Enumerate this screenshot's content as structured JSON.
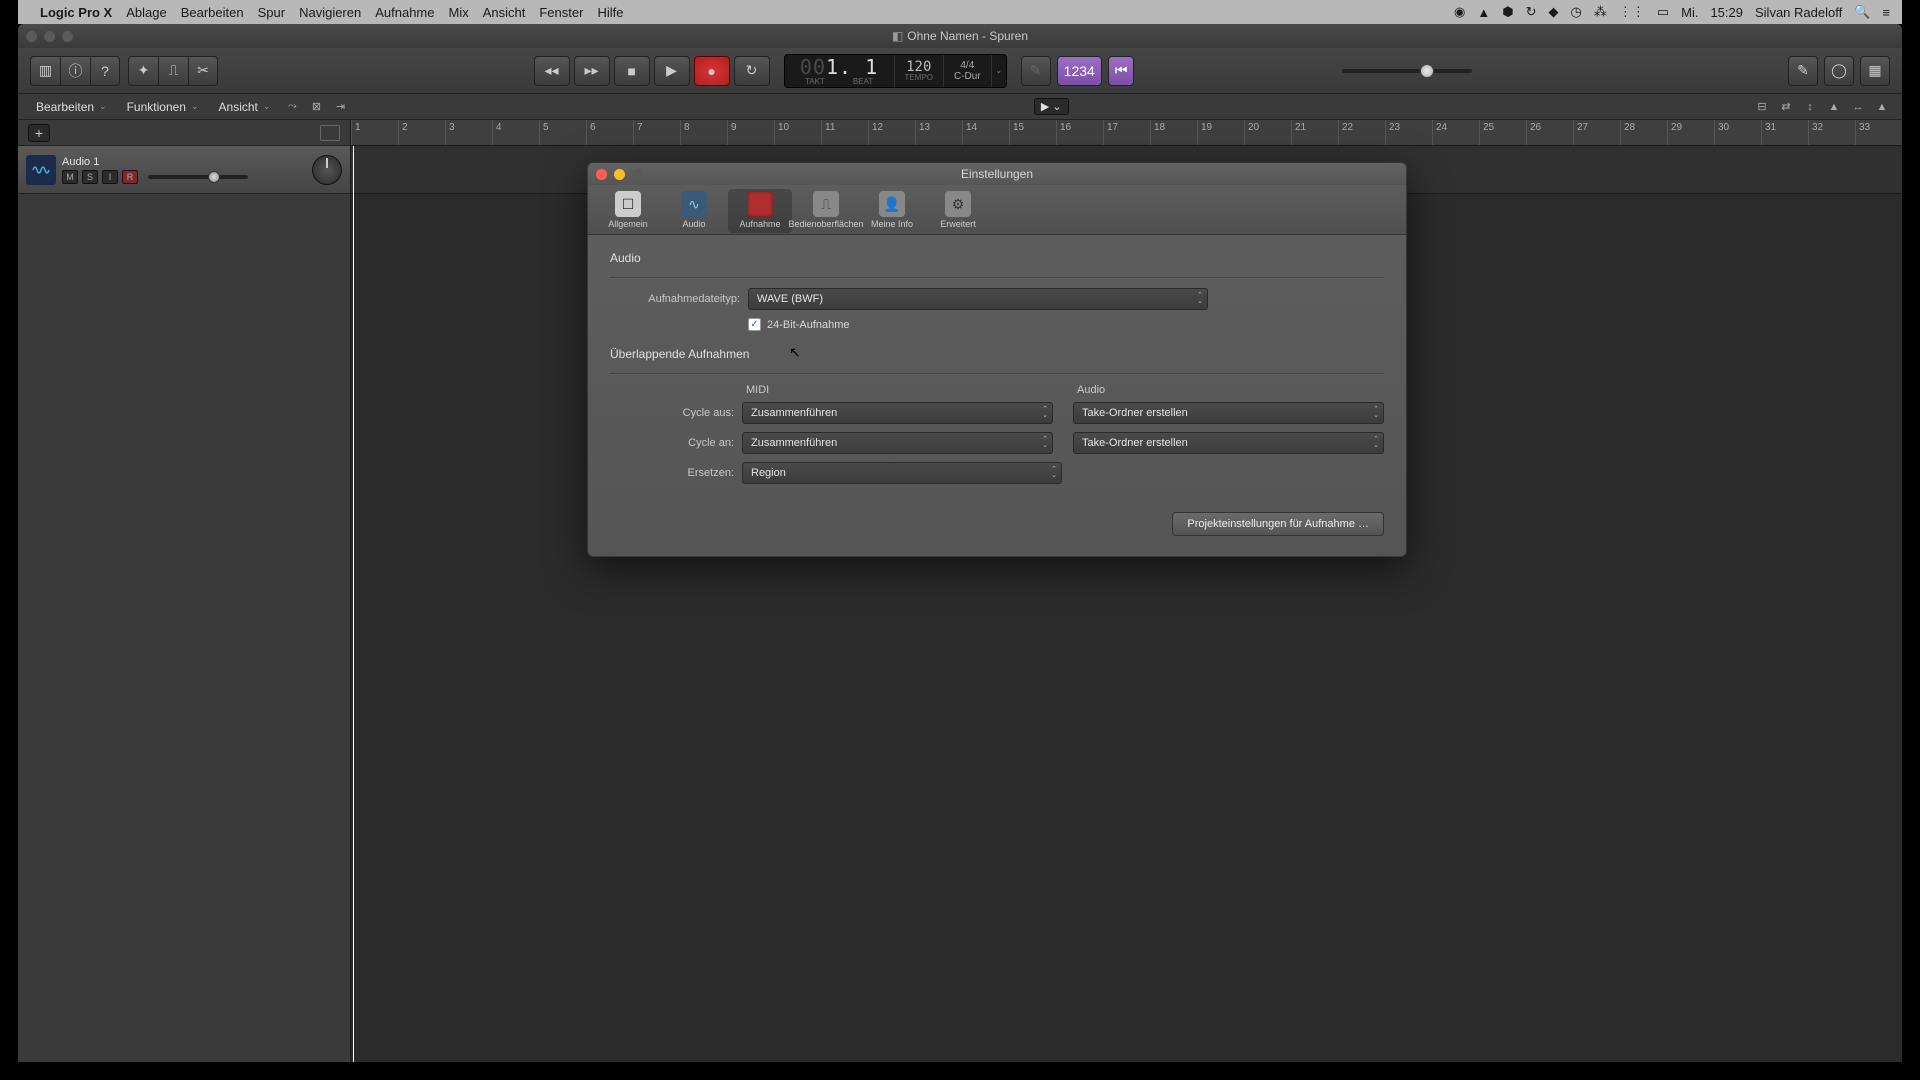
{
  "menubar": {
    "appname": "Logic Pro X",
    "items": [
      "Ablage",
      "Bearbeiten",
      "Spur",
      "Navigieren",
      "Aufnahme",
      "Mix",
      "Ansicht",
      "Fenster",
      "Hilfe"
    ],
    "right": {
      "day": "Mi.",
      "time": "15:29",
      "user": "Silvan Radeloff"
    }
  },
  "window": {
    "title": "Ohne Namen - Spuren"
  },
  "lcd": {
    "position": "1. 1",
    "pos_label_l": "TAKT",
    "pos_label_r": "BEAT",
    "tempo": "120",
    "tempo_label": "TEMPO",
    "sig": "4/4",
    "key": "C-Dur"
  },
  "metronome": "1234",
  "toolbar2": {
    "edit": "Bearbeiten",
    "func": "Funktionen",
    "view": "Ansicht"
  },
  "track": {
    "name": "Audio 1"
  },
  "ruler_ticks": [
    "1",
    "2",
    "3",
    "4",
    "5",
    "6",
    "7",
    "8",
    "9",
    "10",
    "11",
    "12",
    "13",
    "14",
    "15",
    "16",
    "17",
    "18",
    "19",
    "20",
    "21",
    "22",
    "23",
    "24",
    "25",
    "26",
    "27",
    "28",
    "29",
    "30",
    "31",
    "32",
    "33"
  ],
  "modal": {
    "title": "Einstellungen",
    "tabs": {
      "allgemein": "Allgemein",
      "audio": "Audio",
      "aufnahme": "Aufnahme",
      "bedien": "Bedienoberflächen",
      "meine": "Meine Info",
      "erweitert": "Erweitert"
    },
    "section_audio": "Audio",
    "filetype_label": "Aufnahmedateityp:",
    "filetype_value": "WAVE (BWF)",
    "bit_label": "24-Bit-Aufnahme",
    "section_overlap": "Überlappende Aufnahmen",
    "col_midi": "MIDI",
    "col_audio": "Audio",
    "row_cycle_off": "Cycle aus:",
    "row_cycle_on": "Cycle an:",
    "row_replace": "Ersetzen:",
    "midi": {
      "cycle_off": "Zusammenführen",
      "cycle_on": "Zusammenführen",
      "replace": "Region"
    },
    "audio": {
      "cycle_off": "Take-Ordner erstellen",
      "cycle_on": "Take-Ordner erstellen"
    },
    "footer_btn": "Projekteinstellungen für Aufnahme …"
  }
}
